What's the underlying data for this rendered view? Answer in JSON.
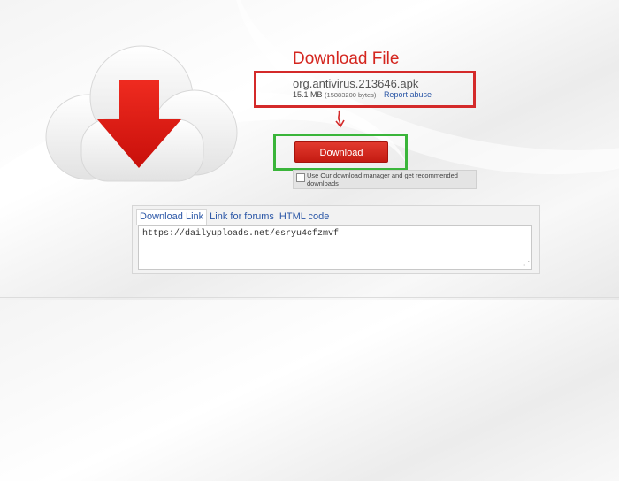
{
  "heading": "Download File",
  "file": {
    "name": "org.antivirus.213646.apk",
    "size": "15.1 MB",
    "bytes": "(15883200 bytes)",
    "report_link": "Report abuse"
  },
  "download_button": "Download",
  "manager_option": "Use Our download manager and get recommended downloads",
  "tabs": [
    "Download Link",
    "Link for forums",
    "HTML code"
  ],
  "link_value": "https://dailyuploads.net/esryu4cfzmvf",
  "colors": {
    "heading": "#d4261f",
    "button": "#d12a20",
    "red_box": "#d42a2a",
    "green_box": "#3ab53a",
    "link": "#2a56a6"
  },
  "icons": [
    "cloud-download-icon",
    "hand-drawn-arrow-icon"
  ]
}
